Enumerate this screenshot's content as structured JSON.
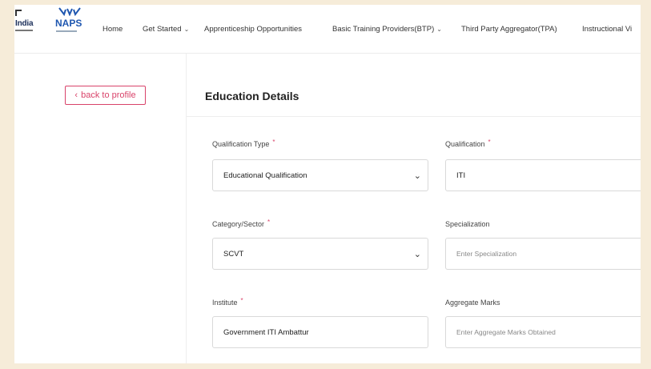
{
  "header": {
    "logos": {
      "india": "India",
      "naps": "NAPS"
    },
    "nav": [
      {
        "label": "Home",
        "dropdown": false
      },
      {
        "label": "Get Started",
        "dropdown": true
      },
      {
        "label": "Apprenticeship Opportunities",
        "dropdown": false
      },
      {
        "label": "Basic Training Providers(BTP)",
        "dropdown": true
      },
      {
        "label": "Third Party Aggregator(TPA)",
        "dropdown": false
      },
      {
        "label": "Instructional Vi",
        "dropdown": false
      }
    ]
  },
  "sidebar": {
    "back_label": "back to profile",
    "back_icon": "chevron-left-icon"
  },
  "form": {
    "title": "Education Details",
    "qualification_type": {
      "label": "Qualification Type",
      "required": "*",
      "value": "Educational Qualification"
    },
    "qualification": {
      "label": "Qualification",
      "required": "*",
      "value": "ITI"
    },
    "category": {
      "label": "Category/Sector",
      "required": "*",
      "value": "SCVT"
    },
    "specialization": {
      "label": "Specialization",
      "placeholder": "Enter Specialization"
    },
    "institute": {
      "label": "Institute",
      "required": "*",
      "value": "Government ITI Ambattur"
    },
    "aggregate": {
      "label": "Aggregate Marks",
      "placeholder": "Enter Aggregate Marks Obtained"
    }
  },
  "colors": {
    "accent": "#d9436a",
    "page_bg": "#f6ecd9",
    "naps_blue": "#1f57b0"
  }
}
